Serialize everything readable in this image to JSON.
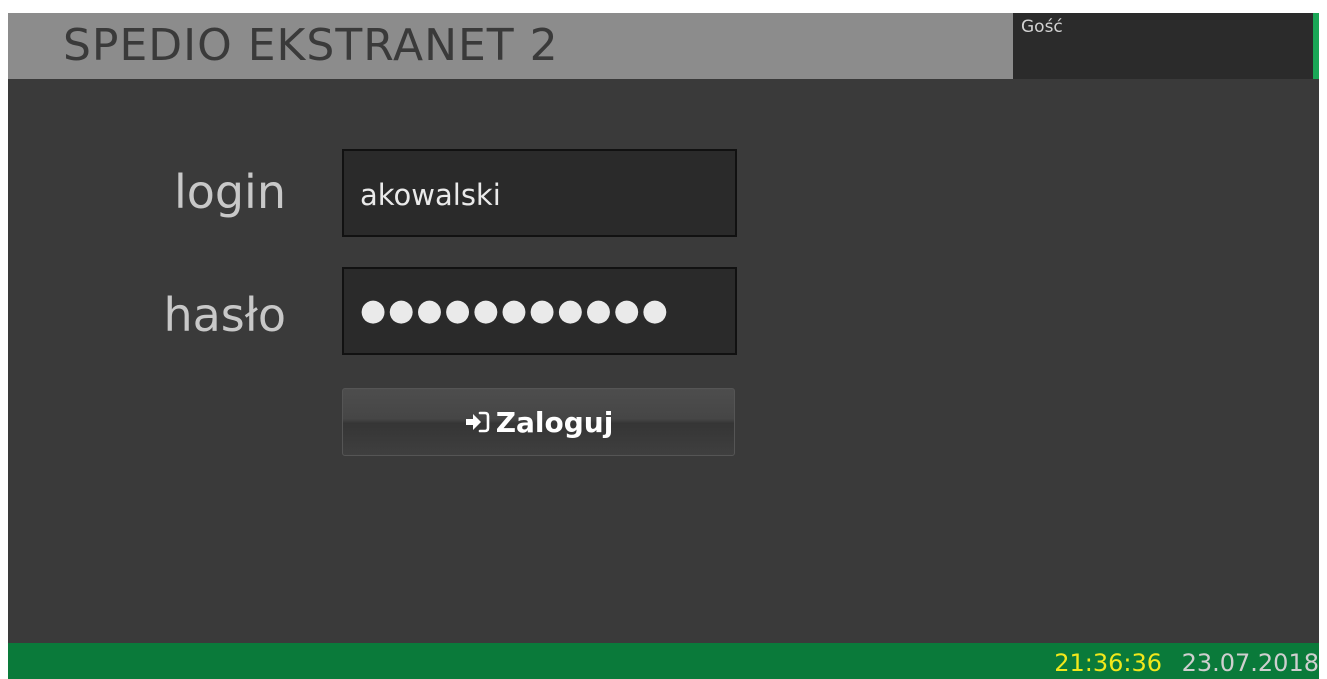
{
  "header": {
    "app_title": "SPEDIO EKSTRANET 2",
    "user_name": "Gość"
  },
  "form": {
    "login_label": "login",
    "login_value": "akowalski",
    "password_label": "hasło",
    "password_mask": "●●●●●●●●●●●",
    "submit_label": "Zaloguj",
    "submit_icon": "sign-in-icon"
  },
  "footer": {
    "time": "21:36:36",
    "date": "23.07.2018"
  },
  "colors": {
    "title_bar": "#8c8c8c",
    "background": "#3a3a3a",
    "footer": "#0a7a3a",
    "accent_green": "#1aa757",
    "time_yellow": "#f1e81b"
  }
}
